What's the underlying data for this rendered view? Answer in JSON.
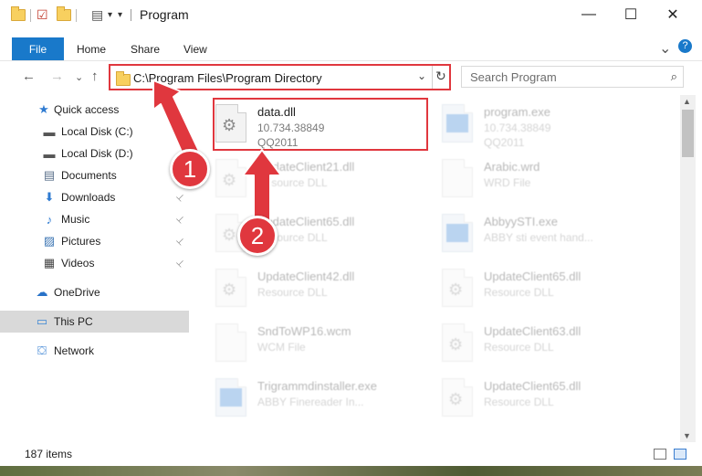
{
  "window": {
    "title": "Program",
    "controls": {
      "minimize": "—",
      "maximize": "☐",
      "close": "✕"
    }
  },
  "ribbon": {
    "tabs": [
      {
        "label": "File"
      },
      {
        "label": "Home"
      },
      {
        "label": "Share"
      },
      {
        "label": "View"
      }
    ],
    "collapse_glyph": "⌄",
    "help_glyph": "?"
  },
  "navigation": {
    "back": "←",
    "forward": "→",
    "recent": "⌄",
    "up": "↑",
    "address": "C:\\Program Files\\Program Directory",
    "address_dropdown": "⌄",
    "refresh": "↻",
    "search_placeholder": "Search Program",
    "search_icon": "⌕"
  },
  "sidebar": {
    "items": [
      {
        "label": "Quick access",
        "icon": "star-icon",
        "glyph": "★",
        "color": "#2f7bd1",
        "pinned": false
      },
      {
        "label": "Local Disk (C:)",
        "icon": "drive-icon",
        "glyph": "▬",
        "color": "#555555",
        "pinned": true
      },
      {
        "label": "Local Disk (D:)",
        "icon": "drive-icon",
        "glyph": "▬",
        "color": "#555555",
        "pinned": false
      },
      {
        "label": "Documents",
        "icon": "documents-icon",
        "glyph": "▤",
        "color": "#5a6f8a",
        "pinned": true
      },
      {
        "label": "Downloads",
        "icon": "download-icon",
        "glyph": "⬇",
        "color": "#2f7bd1",
        "pinned": true
      },
      {
        "label": "Music",
        "icon": "music-icon",
        "glyph": "♪",
        "color": "#2f7bd1",
        "pinned": true
      },
      {
        "label": "Pictures",
        "icon": "pictures-icon",
        "glyph": "▨",
        "color": "#3f77b4",
        "pinned": true
      },
      {
        "label": "Videos",
        "icon": "video-icon",
        "glyph": "▦",
        "color": "#444444",
        "pinned": true
      },
      {
        "label": "OneDrive",
        "icon": "cloud-icon",
        "glyph": "☁",
        "color": "#2872c8",
        "pinned": false
      },
      {
        "label": "This PC",
        "icon": "computer-icon",
        "glyph": "▭",
        "color": "#3b86d4",
        "pinned": false
      },
      {
        "label": "Network",
        "icon": "network-icon",
        "glyph": "⛋",
        "color": "#2f7bd1",
        "pinned": false
      }
    ],
    "selected_label": "This PC",
    "pin_glyph": "📌"
  },
  "files": [
    {
      "name": "data.dll",
      "line1": "10.734.38849",
      "line2": "QQ2011",
      "kind": "dll",
      "highlighted": true
    },
    {
      "name": "program.exe",
      "line1": "10.734.38849",
      "line2": "QQ2011",
      "kind": "exe",
      "highlighted": false
    },
    {
      "name": "UpdateClient21.dll",
      "line1": "Resource DLL",
      "line2": "",
      "kind": "dll",
      "highlighted": false
    },
    {
      "name": "Arabic.wrd",
      "line1": "WRD File",
      "line2": "",
      "kind": "plain",
      "highlighted": false
    },
    {
      "name": "UpdateClient65.dll",
      "line1": "Resource DLL",
      "line2": "",
      "kind": "dll",
      "highlighted": false
    },
    {
      "name": "AbbyySTI.exe",
      "line1": "ABBY sti event hand...",
      "line2": "",
      "kind": "exe",
      "highlighted": false
    },
    {
      "name": "UpdateClient42.dll",
      "line1": "Resource DLL",
      "line2": "",
      "kind": "dll",
      "highlighted": false
    },
    {
      "name": "UpdateClient65.dll",
      "line1": "Resource DLL",
      "line2": "",
      "kind": "dll",
      "highlighted": false
    },
    {
      "name": "SndToWP16.wcm",
      "line1": "WCM File",
      "line2": "",
      "kind": "plain",
      "highlighted": false
    },
    {
      "name": "UpdateClient63.dll",
      "line1": "Resource DLL",
      "line2": "",
      "kind": "dll",
      "highlighted": false
    },
    {
      "name": "Trigrammdinstaller.exe",
      "line1": "ABBY Finereader In...",
      "line2": "",
      "kind": "exe",
      "highlighted": false
    },
    {
      "name": "UpdateClient65.dll",
      "line1": "Resource DLL",
      "line2": "",
      "kind": "dll",
      "highlighted": false
    }
  ],
  "status": {
    "item_count": "187 items"
  },
  "annotations": [
    {
      "number": "1",
      "color": "#e0373e"
    },
    {
      "number": "2",
      "color": "#e0373e"
    }
  ],
  "colors": {
    "accent": "#1979ca",
    "highlight": "#e0373e",
    "selected_bg": "#d9d9d9"
  }
}
